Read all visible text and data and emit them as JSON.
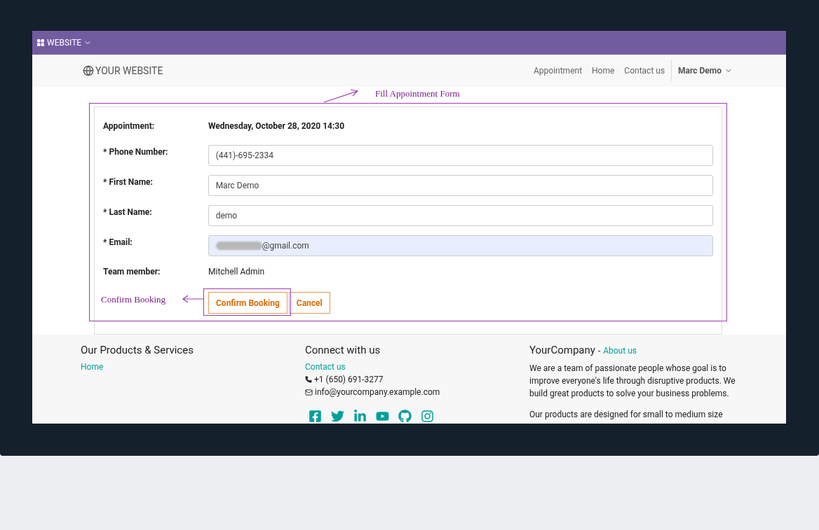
{
  "admin_bar": {
    "app_menu": "WEBSITE"
  },
  "navbar": {
    "logo": "YOUR WEBSITE",
    "links": [
      {
        "label": "Appointment"
      },
      {
        "label": "Home"
      },
      {
        "label": "Contact us"
      }
    ],
    "user": "Marc Demo"
  },
  "form": {
    "appointment": {
      "label": "Appointment:",
      "value": "Wednesday, October 28, 2020 14:30"
    },
    "fields": [
      {
        "label": "* Phone Number:",
        "value": "(441)-695-2334",
        "focused": false,
        "redacted": false
      },
      {
        "label": "* First Name:",
        "value": "Marc Demo",
        "focused": false,
        "redacted": false
      },
      {
        "label": "* Last Name:",
        "value": "demo",
        "focused": false,
        "redacted": false
      },
      {
        "label": "* Email:",
        "value": "@gmail.com",
        "focused": true,
        "redacted": true
      }
    ],
    "team_member": {
      "label": "Team member:",
      "value": "Mitchell Admin"
    },
    "buttons": [
      "Confirm Booking",
      "Cancel"
    ]
  },
  "annotations": [
    {
      "text": "Fill Appointment Form"
    },
    {
      "text": "Confirm Booking"
    }
  ],
  "footer": {
    "columns": [
      {
        "title": "Our Products & Services",
        "links": [
          "Home"
        ]
      },
      {
        "title": "Connect with us",
        "link": "Contact us",
        "phone": "+1 (650) 691-3277",
        "email": "info@yourcompany.example.com"
      },
      {
        "title": "YourCompany",
        "separator": "-",
        "link": "About us",
        "paragraphs": [
          "We are a team of passionate people whose goal is to improve everyone's life through disruptive products. We build great products to solve your business problems.",
          "Our products are designed for small to medium size"
        ]
      }
    ]
  }
}
